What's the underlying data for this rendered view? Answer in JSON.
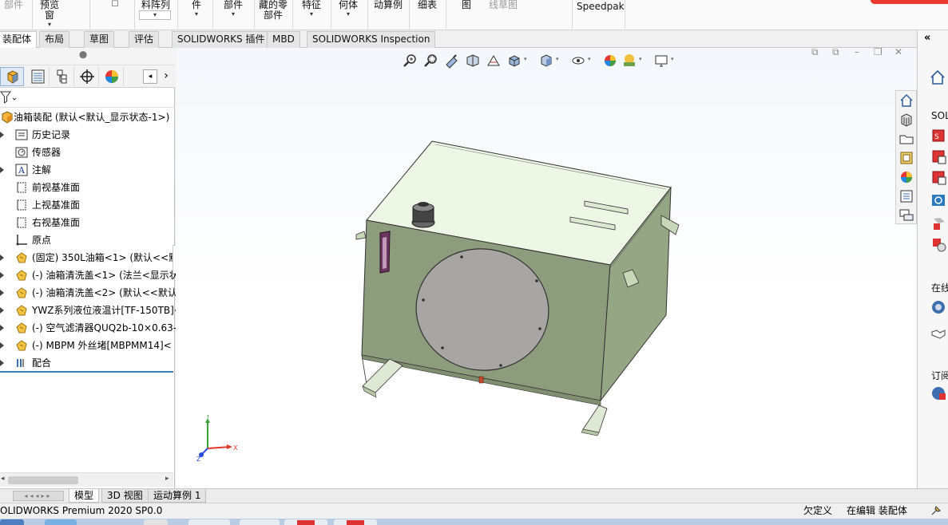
{
  "ribbon": {
    "buttons": [
      {
        "label": "部件",
        "disabled": true
      },
      {
        "label": "预览窗",
        "disabled": true
      },
      {
        "label": "料阵列",
        "disabled": false
      },
      {
        "label": "件",
        "disabled": false
      },
      {
        "label": "部件",
        "disabled": false
      },
      {
        "label": "藏的零\n部件",
        "disabled": false
      },
      {
        "label": "特征",
        "disabled": false
      },
      {
        "label": "何体",
        "disabled": false
      },
      {
        "label": "动算例",
        "disabled": false
      },
      {
        "label": "细表",
        "disabled": false
      },
      {
        "label": "图",
        "disabled": false
      },
      {
        "label": "线草图",
        "disabled": true
      },
      {
        "label": "Speedpak",
        "disabled": false
      }
    ]
  },
  "tabs": [
    {
      "label": "装配体",
      "active": true
    },
    {
      "label": "布局",
      "active": false
    },
    {
      "label": "草图",
      "active": false
    },
    {
      "label": "评估",
      "active": false
    },
    {
      "label": "SOLIDWORKS 插件",
      "active": false
    },
    {
      "label": "MBD",
      "active": false
    },
    {
      "label": "SOLIDWORKS Inspection",
      "active": false
    }
  ],
  "tree": {
    "root": "油箱装配 (默认<默认_显示状态-1>)",
    "items": [
      {
        "label": "历史记录",
        "icon": "history-icon"
      },
      {
        "label": "传感器",
        "icon": "sensor-icon"
      },
      {
        "label": "注解",
        "icon": "annotation-icon"
      },
      {
        "label": "前视基准面",
        "icon": "plane-icon"
      },
      {
        "label": "上视基准面",
        "icon": "plane-icon"
      },
      {
        "label": "右视基准面",
        "icon": "plane-icon"
      },
      {
        "label": "原点",
        "icon": "origin-icon"
      },
      {
        "label": "(固定) 350L油箱<1> (默认<<默i",
        "icon": "part-icon"
      },
      {
        "label": "(-) 油箱清洗盖<1> (法兰<显示状",
        "icon": "part-icon"
      },
      {
        "label": "(-) 油箱清洗盖<2> (默认<<默认",
        "icon": "part-icon"
      },
      {
        "label": "YWZ系列液位液温计[TF-150TB]<",
        "icon": "part-icon"
      },
      {
        "label": "(-) 空气滤清器QUQ2b-10×0.63-",
        "icon": "part-icon"
      },
      {
        "label": "(-) MBPM 外丝堵[MBPMM14]<",
        "icon": "part-icon"
      },
      {
        "label": "配合",
        "icon": "mates-icon"
      }
    ]
  },
  "task_pane": {
    "labels": [
      "SOLI",
      "在线",
      "订阅"
    ]
  },
  "bottom_tabs": [
    {
      "label": "模型",
      "active": true
    },
    {
      "label": "3D 视图",
      "active": false
    },
    {
      "label": "运动算例 1",
      "active": false
    }
  ],
  "status": {
    "product": "OLIDWORKS Premium 2020 SP0.0",
    "undefined": "欠定义",
    "editing": "在编辑 装配体"
  },
  "triad": {
    "x": "X",
    "y": "Y",
    "z": "Z"
  },
  "colors": {
    "tank_front": "#8c9c7c",
    "tank_side": "#95a685",
    "tank_top": "#eef7e6",
    "cover": "#a8a6a4",
    "active_line": "#3c7fc1"
  }
}
